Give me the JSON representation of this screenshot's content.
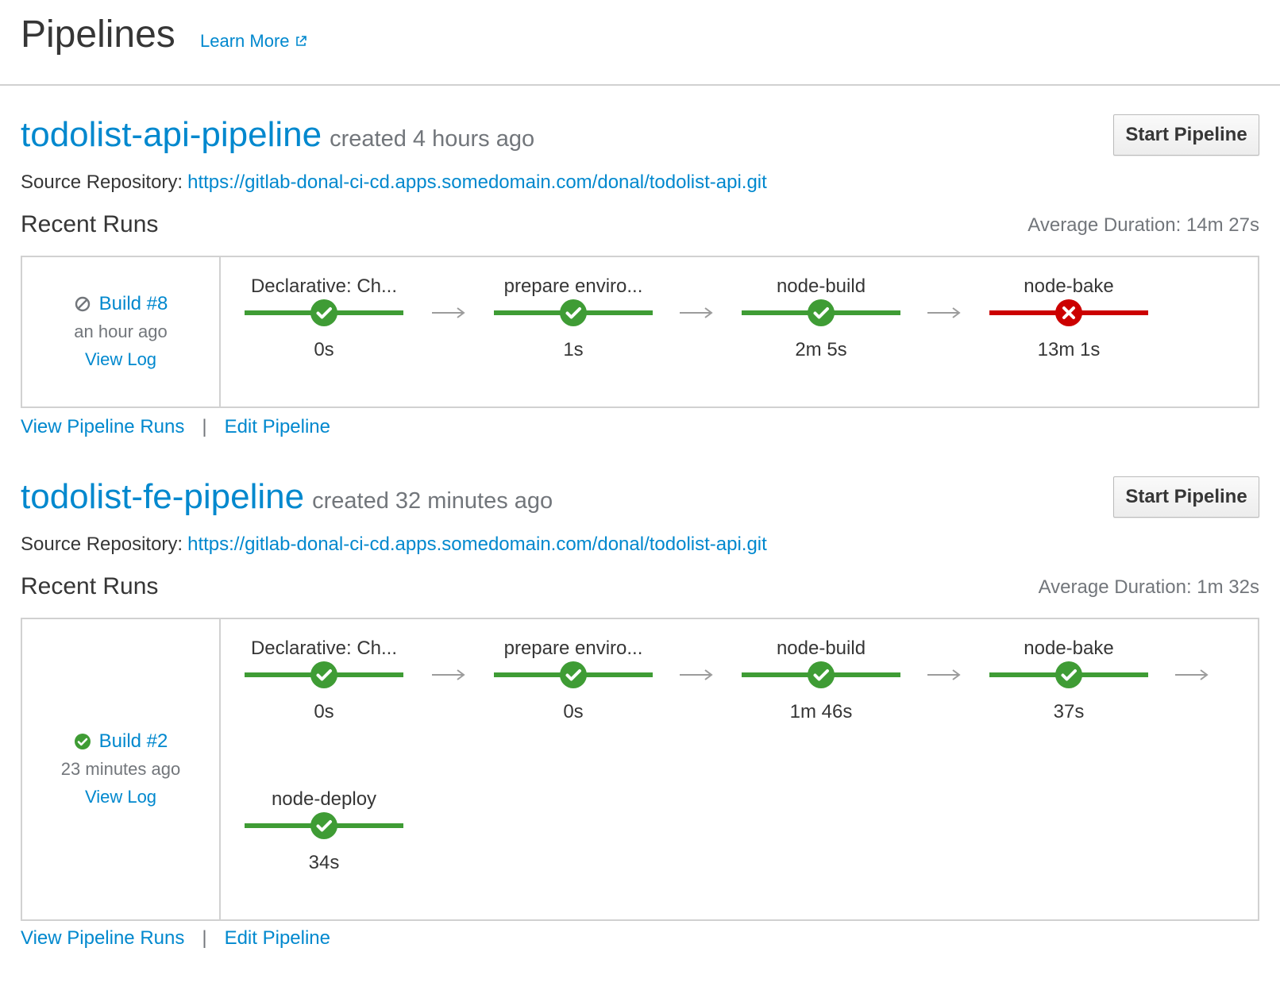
{
  "page": {
    "title": "Pipelines",
    "learn_more": "Learn More"
  },
  "colors": {
    "link": "#0088ce",
    "success": "#3f9c35",
    "failure": "#cc0000",
    "muted": "#72767b",
    "border": "#d1d1d1"
  },
  "pipelines": [
    {
      "name": "todolist-api-pipeline",
      "created": "created 4 hours ago",
      "start_label": "Start Pipeline",
      "source_label": "Source Repository:",
      "source_url": "https://gitlab-donal-ci-cd.apps.somedomain.com/donal/todolist-api.git",
      "recent_runs_label": "Recent Runs",
      "avg_duration": "Average Duration: 14m 27s",
      "run": {
        "build": "Build #8",
        "status_icon": "cancelled-icon",
        "time": "an hour ago",
        "view_log": "View Log"
      },
      "stages": [
        {
          "name": "Declarative: Ch...",
          "duration": "0s",
          "status": "success"
        },
        {
          "name": "prepare enviro...",
          "duration": "1s",
          "status": "success"
        },
        {
          "name": "node-build",
          "duration": "2m 5s",
          "status": "success"
        },
        {
          "name": "node-bake",
          "duration": "13m 1s",
          "status": "failed"
        }
      ],
      "view_runs": "View Pipeline Runs",
      "edit": "Edit Pipeline"
    },
    {
      "name": "todolist-fe-pipeline",
      "created": "created 32 minutes ago",
      "start_label": "Start Pipeline",
      "source_label": "Source Repository:",
      "source_url": "https://gitlab-donal-ci-cd.apps.somedomain.com/donal/todolist-api.git",
      "recent_runs_label": "Recent Runs",
      "avg_duration": "Average Duration: 1m 32s",
      "run": {
        "build": "Build #2",
        "status_icon": "success-icon",
        "time": "23 minutes ago",
        "view_log": "View Log"
      },
      "stages": [
        {
          "name": "Declarative: Ch...",
          "duration": "0s",
          "status": "success"
        },
        {
          "name": "prepare enviro...",
          "duration": "0s",
          "status": "success"
        },
        {
          "name": "node-build",
          "duration": "1m 46s",
          "status": "success"
        },
        {
          "name": "node-bake",
          "duration": "37s",
          "status": "success"
        },
        {
          "name": "node-deploy",
          "duration": "34s",
          "status": "success"
        }
      ],
      "view_runs": "View Pipeline Runs",
      "edit": "Edit Pipeline"
    }
  ]
}
